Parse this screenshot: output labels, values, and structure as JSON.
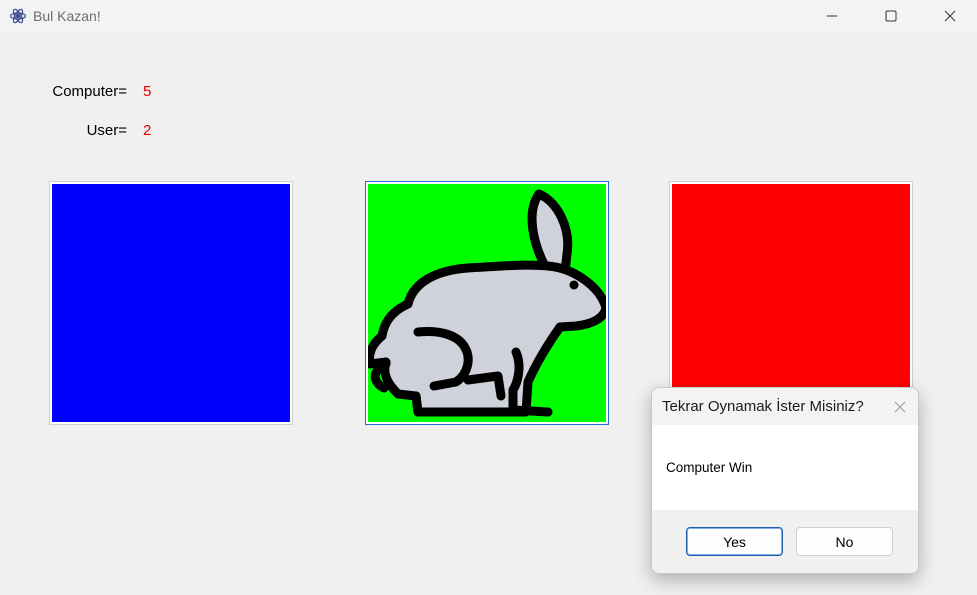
{
  "window": {
    "title": "Bul Kazan!",
    "controls": [
      "minimize-icon",
      "maximize-icon",
      "close-icon"
    ]
  },
  "scoreboard": {
    "computer_label": "Computer=",
    "computer_score": "5",
    "user_label": "User=",
    "user_score": "2",
    "score_color": "#e00000"
  },
  "cards": [
    {
      "color": "#0000ff",
      "content": "empty"
    },
    {
      "color": "#00ff00",
      "content": "rabbit-icon"
    },
    {
      "color": "#ff0000",
      "content": "empty"
    }
  ],
  "dialog": {
    "title": "Tekrar Oynamak İster Misiniz?",
    "message": "Computer Win",
    "yes_label": "Yes",
    "no_label": "No"
  }
}
